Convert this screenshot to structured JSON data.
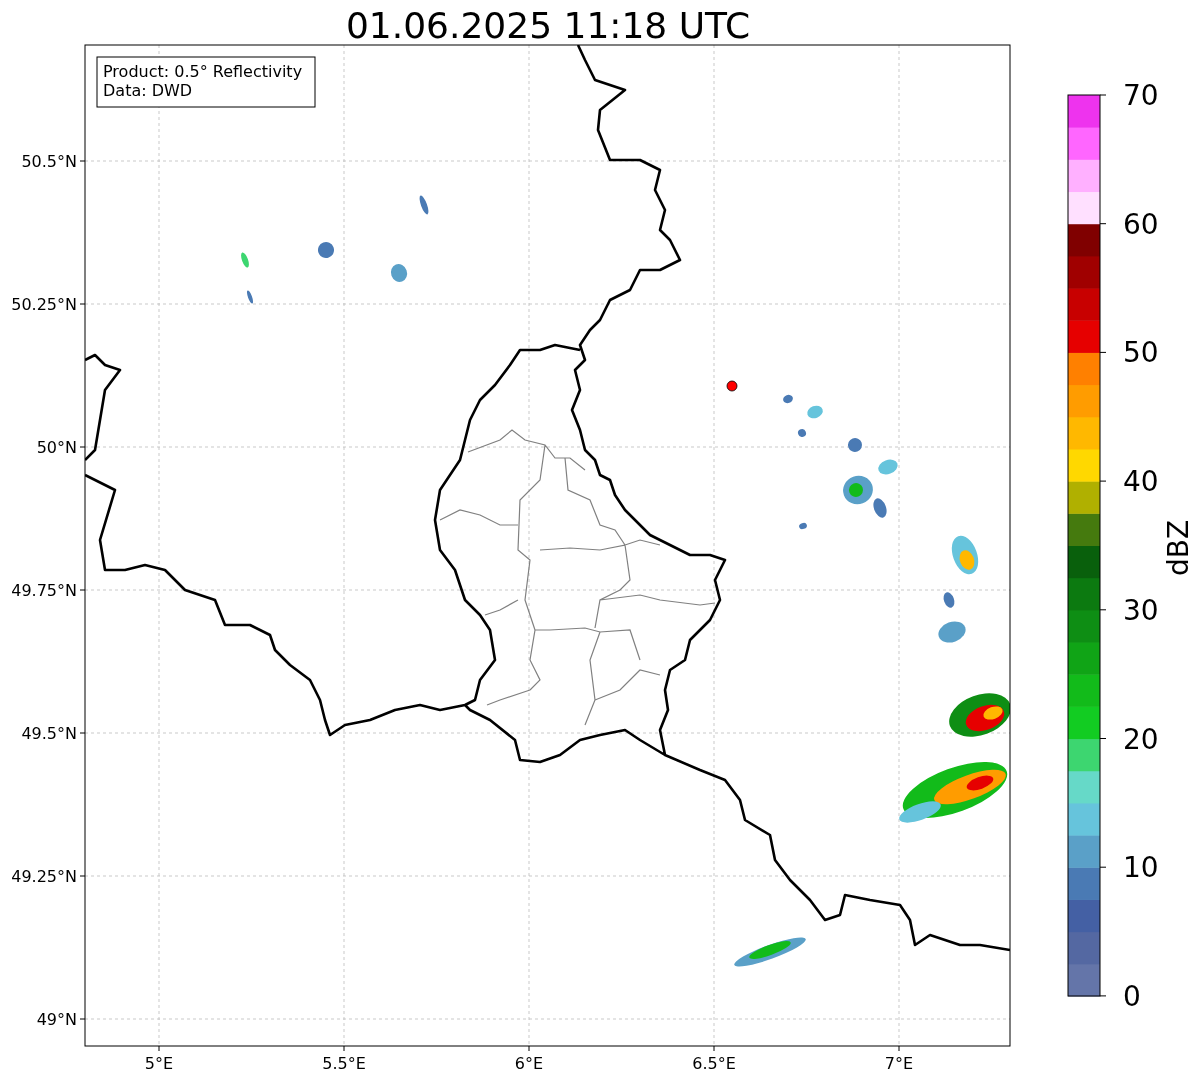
{
  "title": "01.06.2025 11:18 UTC",
  "legend": [
    "Product: 0.5° Reflectivity",
    "Data: DWD"
  ],
  "map": {
    "x_ticks": [
      "5°E",
      "5.5°E",
      "6°E",
      "6.5°E",
      "7°E"
    ],
    "y_ticks": [
      "50.5°N",
      "50.25°N",
      "50°N",
      "49.75°N",
      "49.5°N",
      "49.25°N",
      "49°N"
    ]
  },
  "colorbar": {
    "label": "dBZ",
    "ticks": [
      "70",
      "60",
      "50",
      "40",
      "30",
      "20",
      "10",
      "0"
    ],
    "bins": [
      {
        "color": "#6475a9"
      },
      {
        "color": "#5468a2"
      },
      {
        "color": "#4460a4"
      },
      {
        "color": "#4a7ab4"
      },
      {
        "color": "#5aa0c8"
      },
      {
        "color": "#66c4dc"
      },
      {
        "color": "#66d9c8"
      },
      {
        "color": "#3dd670"
      },
      {
        "color": "#12cc22"
      },
      {
        "color": "#12bb1a"
      },
      {
        "color": "#10a416"
      },
      {
        "color": "#0e8e14"
      },
      {
        "color": "#0c7a10"
      },
      {
        "color": "#09600c"
      },
      {
        "color": "#457a0e"
      },
      {
        "color": "#b0b000"
      },
      {
        "color": "#ffd800"
      },
      {
        "color": "#ffb800"
      },
      {
        "color": "#ff9c00"
      },
      {
        "color": "#ff8000"
      },
      {
        "color": "#e60000"
      },
      {
        "color": "#c80000"
      },
      {
        "color": "#a00000"
      },
      {
        "color": "#800000"
      },
      {
        "color": "#ffe0ff"
      },
      {
        "color": "#ffb0ff"
      },
      {
        "color": "#ff66ff"
      },
      {
        "color": "#ee33ee"
      }
    ]
  }
}
